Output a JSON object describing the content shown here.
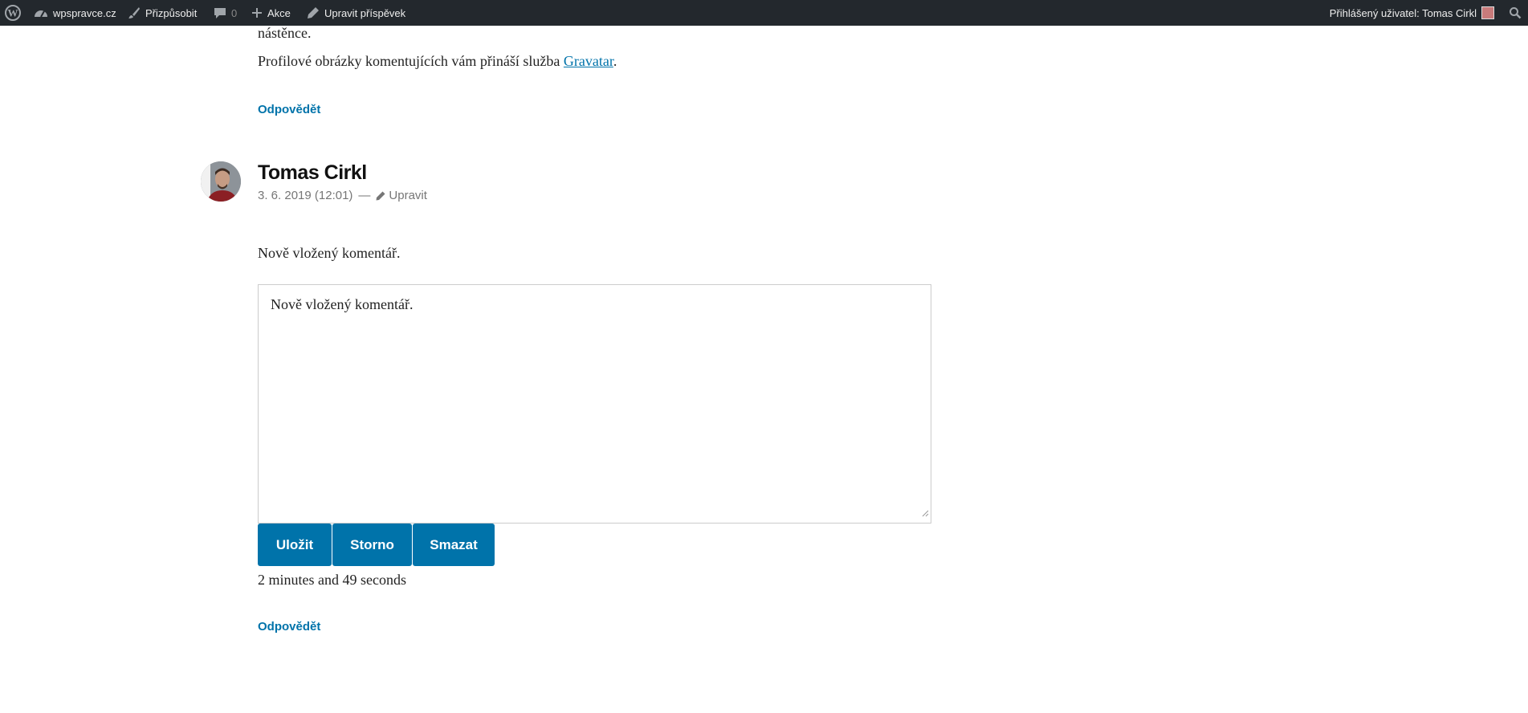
{
  "adminbar": {
    "site_name": "wpspravce.cz",
    "customize": "Přizpůsobit",
    "comments_count": "0",
    "new_content": "Akce",
    "edit_post": "Upravit příspěvek",
    "account": "Přihlášený uživatel: Tomas Cirkl"
  },
  "prev_comment": {
    "text_tail": "nástěnce.",
    "gravatar_prefix": "Profilové obrázky komentujících vám přináší služba ",
    "gravatar_link": "Gravatar",
    "gravatar_suffix": ".",
    "reply_label": "Odpovědět"
  },
  "comment": {
    "author": "Tomas Cirkl",
    "date": "3. 6. 2019 (12:01)",
    "separator": "—",
    "edit_label": "Upravit",
    "text": "Nově vložený komentář.",
    "editor_value": "Nově vložený komentář.",
    "save_label": "Uložit",
    "cancel_label": "Storno",
    "delete_label": "Smazat",
    "timer": "2 minutes and 49 seconds",
    "reply_label": "Odpovědět"
  },
  "colors": {
    "accent": "#0073aa",
    "adminbar_bg": "#23282d",
    "meta_text": "#767676"
  }
}
